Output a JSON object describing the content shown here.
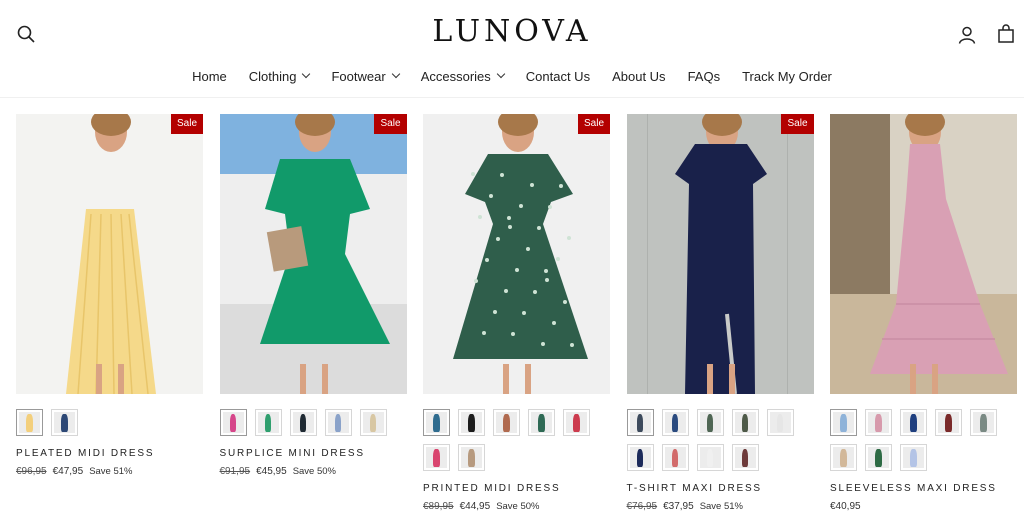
{
  "header": {
    "logo": "LUNOVA",
    "icons": [
      "search-icon",
      "account-icon",
      "cart-icon"
    ],
    "nav": [
      {
        "label": "Home",
        "dropdown": false
      },
      {
        "label": "Clothing",
        "dropdown": true
      },
      {
        "label": "Footwear",
        "dropdown": true
      },
      {
        "label": "Accessories",
        "dropdown": true
      },
      {
        "label": "Contact Us",
        "dropdown": false
      },
      {
        "label": "About Us",
        "dropdown": false
      },
      {
        "label": "FAQs",
        "dropdown": false
      },
      {
        "label": "Track My Order",
        "dropdown": false
      }
    ]
  },
  "colors": {
    "sale_badge": "#b30000",
    "text": "#1c1c1c"
  },
  "products": [
    {
      "name": "PLEATED MIDI DRESS",
      "badge": "Sale",
      "old_price": "€96,95",
      "price": "€47,95",
      "save": "Save 51%",
      "background": "#f3f3f1",
      "dress_color": "#f5d98a",
      "swatches": [
        "#f3cf7c",
        "#2d4876"
      ]
    },
    {
      "name": "SURPLICE MINI DRESS",
      "badge": "Sale",
      "old_price": "€91,95",
      "price": "€45,95",
      "save": "Save 50%",
      "background": "#7fb2df",
      "dress_color": "#119a6a",
      "swatches": [
        "#d6468a",
        "#2f9f6e",
        "#1f2a33",
        "#8aa2c9",
        "#d8c7a3"
      ]
    },
    {
      "name": "PRINTED MIDI DRESS",
      "badge": "Sale",
      "old_price": "€89,95",
      "price": "€44,95",
      "save": "Save 50%",
      "background": "#f0f0f0",
      "dress_color": "#2f5e4b",
      "swatches": [
        "#2f6c8f",
        "#1c1c1c",
        "#b06a4f",
        "#2f6a55",
        "#cc3b4e",
        "#d9456f",
        "#b79a7f"
      ]
    },
    {
      "name": "T-SHIRT MAXI DRESS",
      "badge": "Sale",
      "old_price": "€76,95",
      "price": "€37,95",
      "save": "Save 51%",
      "background": "#c9cbc9",
      "dress_color": "#19214a",
      "swatches": [
        "#3d4a5c",
        "#2a4a7f",
        "#4f6654",
        "#4e5a48",
        "#e6e6e6",
        "#1c2a5a",
        "#d26b6b",
        "#f0f0f0",
        "#6e3b3b"
      ]
    },
    {
      "name": "SLEEVELESS MAXI DRESS",
      "badge": "",
      "old_price": "",
      "price": "€40,95",
      "save": "",
      "background": "#d9d2c4",
      "dress_color": "#d9a0b4",
      "swatches": [
        "#8fb3d9",
        "#d79aac",
        "#1f3f7f",
        "#7a2a2a",
        "#7a8a84",
        "#d2b89a",
        "#2e6b45",
        "#b4c4e6"
      ]
    }
  ]
}
